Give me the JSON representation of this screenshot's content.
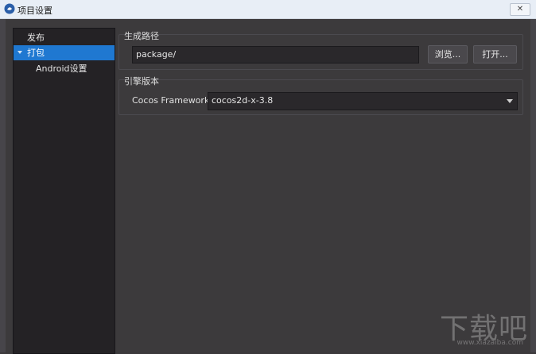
{
  "window": {
    "title": "项目设置",
    "close_label": "✕"
  },
  "sidebar": {
    "items": [
      {
        "label": "发布"
      },
      {
        "label": "打包",
        "expanded": true,
        "selected": true
      },
      {
        "label": "Android设置"
      }
    ]
  },
  "output_path": {
    "title": "生成路径",
    "value": "package/",
    "browse_label": "浏览...",
    "open_label": "打开..."
  },
  "engine": {
    "title": "引擎版本",
    "label": "Cocos Framework",
    "selected": "cocos2d-x-3.8"
  },
  "watermark": {
    "main": "下载吧",
    "sub": "www.xiazaiba.com"
  },
  "colors": {
    "selected_bg": "#1f78d1",
    "panel_bg": "#3c3a3c",
    "sidebar_bg": "#242225"
  },
  "icons": {
    "app": "cocos-app-icon",
    "tree_expand": "triangle-down-icon",
    "dropdown": "chevron-down-icon",
    "close": "close-icon"
  }
}
